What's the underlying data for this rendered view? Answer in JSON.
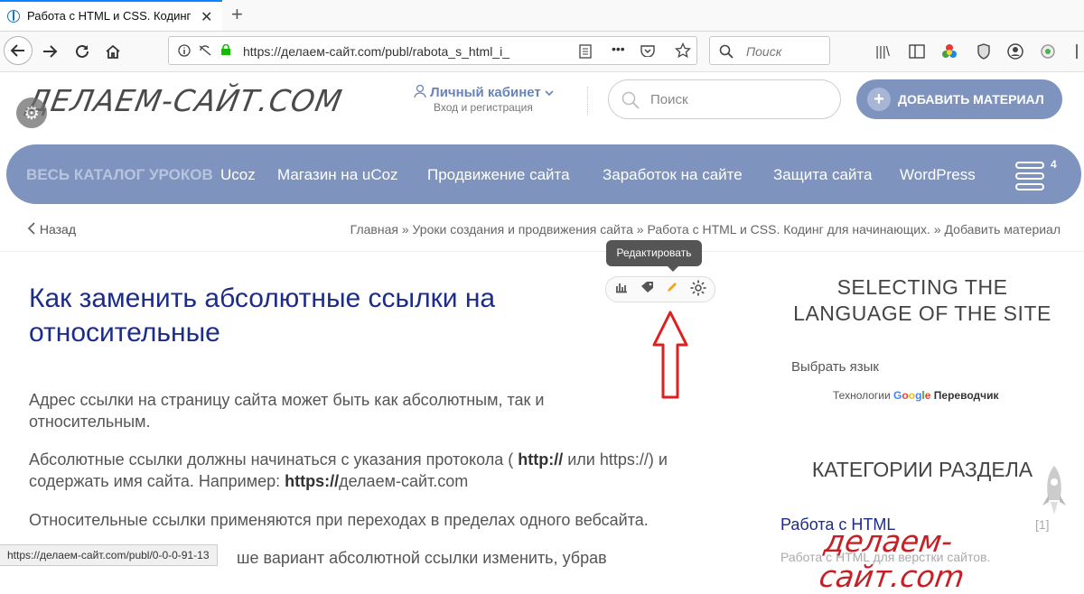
{
  "browser": {
    "tab_title": "Работа с HTML и CSS. Кодинг",
    "tab_close": "✕",
    "new_tab": "+",
    "url": "https://делаем-сайт.com/publ/rabota_s_html_i_",
    "search_placeholder": "Поиск",
    "status_url": "https://делаем-сайт.com/publ/0-0-0-91-13"
  },
  "site": {
    "logo": "ДЕЛАЕМ-САЙТ.COM",
    "cabinet_label": "Личный кабинет",
    "cabinet_sub": "Вход и регистрация",
    "search_placeholder": "Поиск",
    "add_button": "ДОБАВИТЬ МАТЕРИАЛ",
    "menu_badge": "4",
    "menu": [
      "ВЕСЬ КАТАЛОГ УРОКОВ",
      "Ucoz",
      "Магазин на uCoz",
      "Продвижение сайта",
      "Заработок на сайте",
      "Защита сайта",
      "WordPress"
    ]
  },
  "breadcrumb": {
    "back": "Назад",
    "items": [
      "Главная",
      "Уроки создания и продвижения сайта",
      "Работа с HTML и CSS. Кодинг для начинающих.",
      "Добавить материал"
    ],
    "separator": "»"
  },
  "tools": {
    "tooltip": "Редактировать"
  },
  "article": {
    "title": "Как заменить абсолютные ссылки на относительные",
    "p1": " Адрес ссылки на страницу сайта может быть как абсолютным, так и относительным.",
    "p2_a": " Абсолютные ссылки должны начинаться с указания протокола ( ",
    "p2_b": "http://",
    "p2_c": " или https://) и содержать имя сайта. Например: ",
    "p2_d": "https://",
    "p2_e": "делаем-сайт.com",
    "p3": " Относительные ссылки применяются при переходах в пределах одного вебсайта.",
    "p4": "ше вариант абсолютной ссылки изменить, убрав"
  },
  "sidebar": {
    "lang_title": "SELECTING THE LANGUAGE OF THE SITE",
    "choose_lang": "Выбрать язык",
    "google_prefix": "Технологии",
    "google_suffix": "Переводчик",
    "cat_title": "КАТЕГОРИИ РАЗДЕЛА",
    "cat_item": "Работа с HTML",
    "cat_count": "[1]",
    "cat_desc": "Работа с HTML для верстки сайтов."
  },
  "watermark": "делаем-сайт.com",
  "colors": {
    "accent": "#7f93bf",
    "title": "#1c2c8c",
    "arrow": "#e02020",
    "watermark": "#c62026"
  }
}
